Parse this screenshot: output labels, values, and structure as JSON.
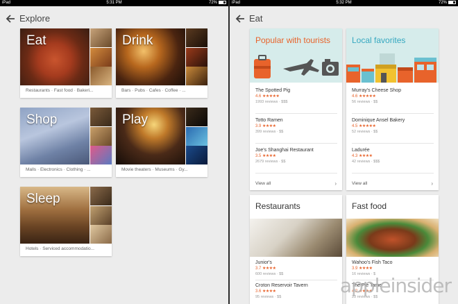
{
  "left": {
    "status": {
      "carrier": "iPad",
      "time": "5:31 PM",
      "battery": "72%"
    },
    "title": "Explore",
    "categories": [
      {
        "label": "Eat",
        "sub": "Restaurants · Fast food · Bakeri..."
      },
      {
        "label": "Drink",
        "sub": "Bars · Pubs · Cafes · Coffee · ..."
      },
      {
        "label": "Shop",
        "sub": "Malls · Electronics · Clothing · ..."
      },
      {
        "label": "Play",
        "sub": "Movie theaters · Museums · Gy..."
      },
      {
        "label": "Sleep",
        "sub": "Hotels · Serviced accommodatio..."
      }
    ]
  },
  "right": {
    "status": {
      "carrier": "iPad",
      "time": "5:32 PM",
      "battery": "72%"
    },
    "title": "Eat",
    "popular": {
      "title": "Popular with tourists",
      "items": [
        {
          "name": "The Spotted Pig",
          "rating": "4.6",
          "stars": "★★★★★",
          "meta": "1993 reviews · $$$"
        },
        {
          "name": "Totto Ramen",
          "rating": "3.9",
          "stars": "★★★★",
          "meta": "399 reviews · $$"
        },
        {
          "name": "Joe's Shanghai Restaurant",
          "rating": "3.5",
          "stars": "★★★★",
          "meta": "2679 reviews · $$"
        }
      ],
      "view_all": "View all"
    },
    "local": {
      "title": "Local favorites",
      "items": [
        {
          "name": "Murray's Cheese Shop",
          "rating": "4.6",
          "stars": "★★★★★",
          "meta": "56 reviews · $$"
        },
        {
          "name": "Dominique Ansel Bakery",
          "rating": "4.5",
          "stars": "★★★★★",
          "meta": "52 reviews · $$"
        },
        {
          "name": "Ladurée",
          "rating": "4.3",
          "stars": "★★★★",
          "meta": "42 reviews · $$$"
        }
      ],
      "view_all": "View all"
    },
    "restaurants": {
      "title": "Restaurants",
      "items": [
        {
          "name": "Junior's",
          "rating": "3.7",
          "stars": "★★★★",
          "meta": "600 reviews · $$"
        },
        {
          "name": "Croton Reservoir Tavern",
          "rating": "3.6",
          "stars": "★★★★",
          "meta": "95 reviews · $$"
        }
      ]
    },
    "fastfood": {
      "title": "Fast food",
      "items": [
        {
          "name": "Wahoo's Fish Taco",
          "rating": "3.9",
          "stars": "★★★★",
          "meta": "16 reviews · $"
        },
        {
          "name": "The Pie Tame",
          "rating": "4.2",
          "stars": "★★★★",
          "meta": "23 reviews · $$"
        }
      ]
    },
    "watermark": "appleinsider"
  },
  "colors": {
    "popular": "#e8632b",
    "local": "#35a8c0",
    "star": "#e8632b"
  }
}
